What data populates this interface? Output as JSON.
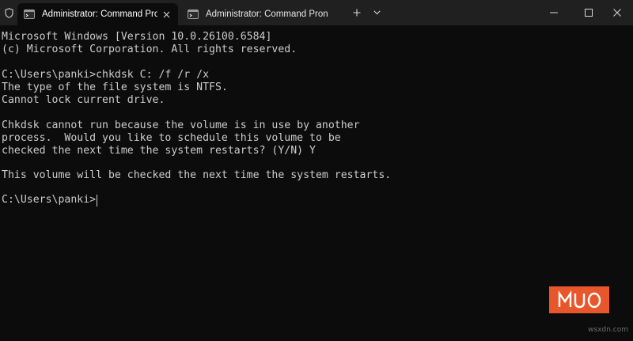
{
  "titlebar": {
    "tabs": [
      {
        "title": "Administrator: Command Pro",
        "active": true,
        "icon": "terminal-icon"
      },
      {
        "title": "Administrator: Command Pron",
        "active": false,
        "icon": "terminal-icon"
      }
    ],
    "new_tab_icon": "plus-icon",
    "dropdown_icon": "chevron-down-icon",
    "admin_icon": "shield-icon",
    "window_controls": [
      "minimize-icon",
      "maximize-icon",
      "close-icon"
    ]
  },
  "terminal": {
    "lines": [
      "Microsoft Windows [Version 10.0.26100.6584]",
      "(c) Microsoft Corporation. All rights reserved.",
      "",
      "C:\\Users\\panki>chkdsk C: /f /r /x",
      "The type of the file system is NTFS.",
      "Cannot lock current drive.",
      "",
      "Chkdsk cannot run because the volume is in use by another",
      "process.  Would you like to schedule this volume to be",
      "checked the next time the system restarts? (Y/N) Y",
      "",
      "This volume will be checked the next time the system restarts.",
      ""
    ],
    "prompt": "C:\\Users\\panki>"
  },
  "watermark": {
    "logo_text": "MUO",
    "site": "wsxdn.com"
  },
  "colors": {
    "background": "#0c0c0c",
    "titlebar": "#202020",
    "text": "#cccccc",
    "logo": "#e8572b"
  }
}
